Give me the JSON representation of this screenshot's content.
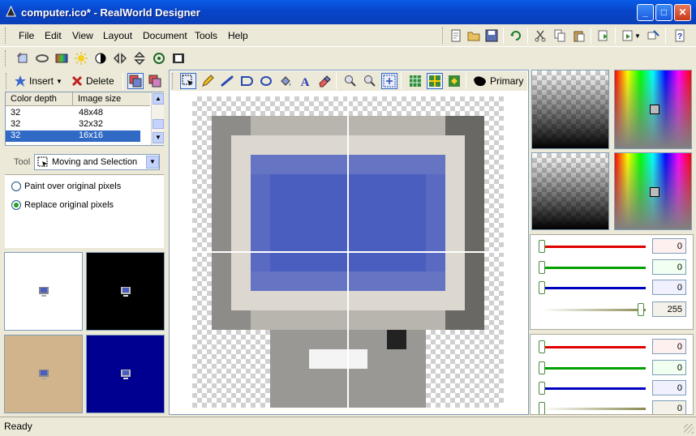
{
  "window": {
    "title": "computer.ico* - RealWorld Designer"
  },
  "menu": {
    "items": [
      "File",
      "Edit",
      "View",
      "Layout",
      "Document",
      "Tools",
      "Help"
    ]
  },
  "layers_toolbar": {
    "insert_label": "Insert",
    "delete_label": "Delete"
  },
  "image_table": {
    "headers": [
      "Color depth",
      "Image size"
    ],
    "rows": [
      {
        "depth": "32",
        "size": "48x48",
        "selected": false
      },
      {
        "depth": "32",
        "size": "32x32",
        "selected": false
      },
      {
        "depth": "32",
        "size": "16x16",
        "selected": true
      }
    ]
  },
  "tool_options": {
    "tool_label": "Tool",
    "tool_value": "Moving and Selection",
    "option1": "Paint over original pixels",
    "option2": "Replace original pixels",
    "selected_option": 2
  },
  "canvas_toolbar": {
    "primary_label": "Primary"
  },
  "colors": {
    "primary_values": [
      "0",
      "0",
      "0",
      "255"
    ],
    "secondary_values": [
      "0",
      "0",
      "0",
      "0"
    ],
    "accent": "#316AC5"
  },
  "status": {
    "text": "Ready"
  }
}
